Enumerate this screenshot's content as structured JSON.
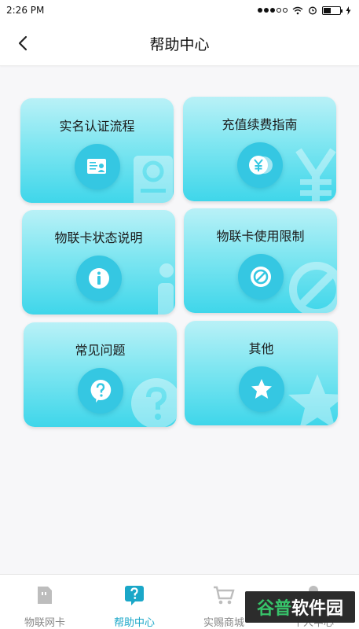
{
  "status_bar": {
    "time": "2:26 PM"
  },
  "header": {
    "title": "帮助中心"
  },
  "cards": [
    {
      "label": "实名认证流程",
      "icon": "certificate-icon"
    },
    {
      "label": "充值续费指南",
      "icon": "yen-coin-icon"
    },
    {
      "label": "物联卡状态说明",
      "icon": "info-icon"
    },
    {
      "label": "物联卡使用限制",
      "icon": "prohibited-icon"
    },
    {
      "label": "常见问题",
      "icon": "question-bubble-icon"
    },
    {
      "label": "其他",
      "icon": "star-icon"
    }
  ],
  "tabbar": {
    "tabs": [
      {
        "label": "物联网卡",
        "icon": "sim-card-icon",
        "active": false
      },
      {
        "label": "帮助中心",
        "icon": "help-icon",
        "active": true
      },
      {
        "label": "实赐商城",
        "icon": "cart-icon",
        "active": false
      },
      {
        "label": "个人中心",
        "icon": "person-icon",
        "active": false
      }
    ]
  },
  "watermark": {
    "text_a": "谷普",
    "text_b": "软件园"
  },
  "colors": {
    "accent": "#1aa7c8",
    "card_icon_bg": "#35c7e2",
    "card_top": "#b9f1f7",
    "card_bottom": "#3fd6ea"
  }
}
